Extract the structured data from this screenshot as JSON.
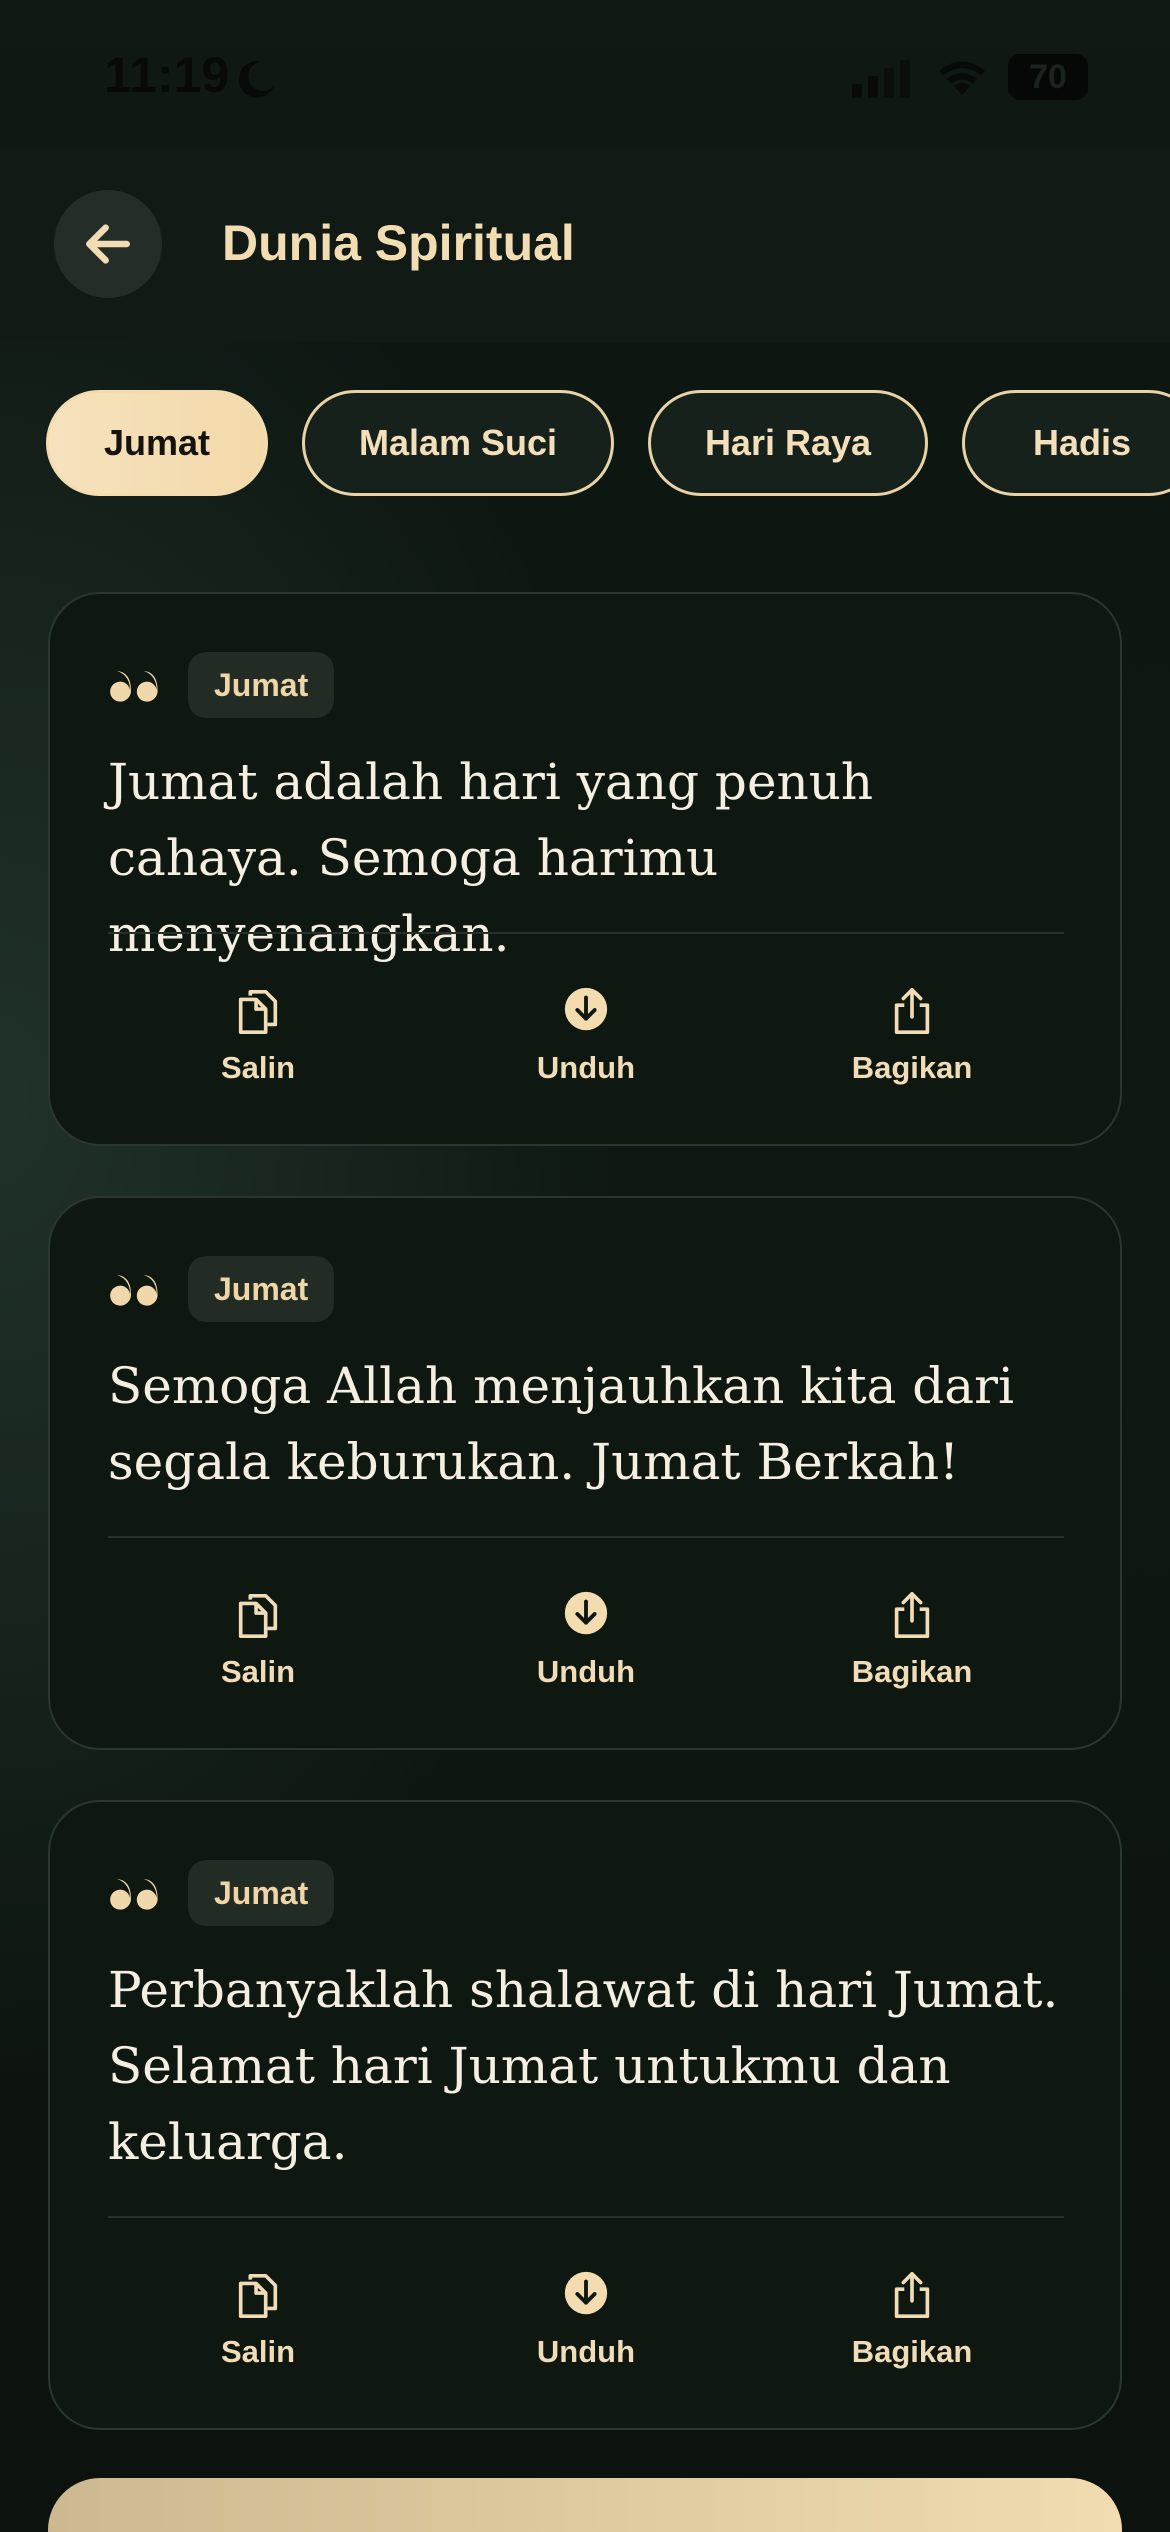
{
  "status_bar": {
    "time": "11:19",
    "battery": "70",
    "icons": [
      "moon-icon",
      "signal-icon",
      "wifi-icon",
      "battery-icon"
    ]
  },
  "header": {
    "title": "Dunia Spiritual",
    "back_icon": "arrow-left-icon"
  },
  "categories": [
    {
      "label": "Jumat",
      "active": true
    },
    {
      "label": "Malam Suci",
      "active": false
    },
    {
      "label": "Hari Raya",
      "active": false
    },
    {
      "label": "Hadis",
      "active": false
    }
  ],
  "cards": [
    {
      "tag": "Jumat",
      "text": "Jumat adalah hari yang penuh cahaya. Semoga harimu menyenangkan."
    },
    {
      "tag": "Jumat",
      "text": "Semoga Allah menjauhkan kita dari segala keburukan. Jumat Berkah!"
    },
    {
      "tag": "Jumat",
      "text": "Perbanyaklah shalawat di hari Jumat. Selamat hari Jumat untukmu dan keluarga."
    }
  ],
  "actions": {
    "copy": "Salin",
    "download": "Unduh",
    "share": "Bagikan"
  },
  "colors": {
    "accent": "#f3dcb0",
    "background": "#0d140f",
    "card": "#0f1711",
    "tag_bg": "#222b24"
  }
}
